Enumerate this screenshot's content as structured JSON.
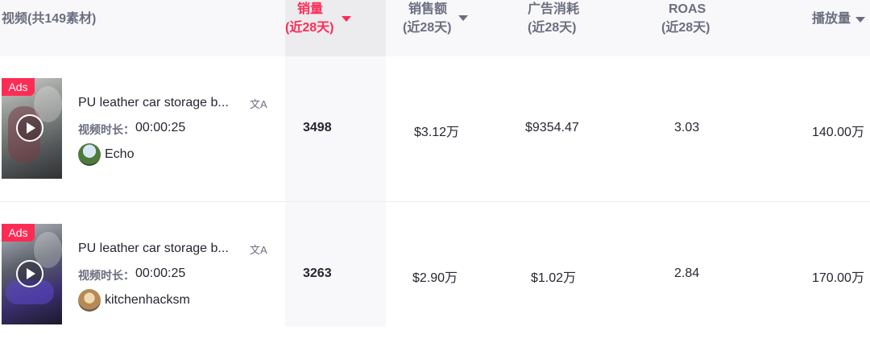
{
  "header": {
    "video_col": "视频(共149素材)",
    "sales": {
      "line1": "销量",
      "line2": "(近28天)"
    },
    "revenue": {
      "line1": "销售额",
      "line2": "(近28天)"
    },
    "ad_spend": {
      "line1": "广告消耗",
      "line2": "(近28天)"
    },
    "roas": {
      "line1": "ROAS",
      "line2": "(近28天)"
    },
    "views": {
      "line1": "播放量"
    }
  },
  "duration_label": "视频时长：",
  "ads_badge": "Ads",
  "translate_icon_glyph": "文A",
  "rows": [
    {
      "title": "PU leather car storage b...",
      "duration": "00:00:25",
      "author": "Echo",
      "sales": "3498",
      "revenue": "$3.12万",
      "ad_spend": "$9354.47",
      "roas": "3.03",
      "views": "140.00万"
    },
    {
      "title": "PU leather car storage b...",
      "duration": "00:00:25",
      "author": "kitchenhacksm",
      "sales": "3263",
      "revenue": "$2.90万",
      "ad_spend": "$1.02万",
      "roas": "2.84",
      "views": "170.00万"
    }
  ],
  "colors": {
    "accent": "#fe2c55",
    "header_bg": "#f8f8fa",
    "muted": "#6b6e80"
  }
}
